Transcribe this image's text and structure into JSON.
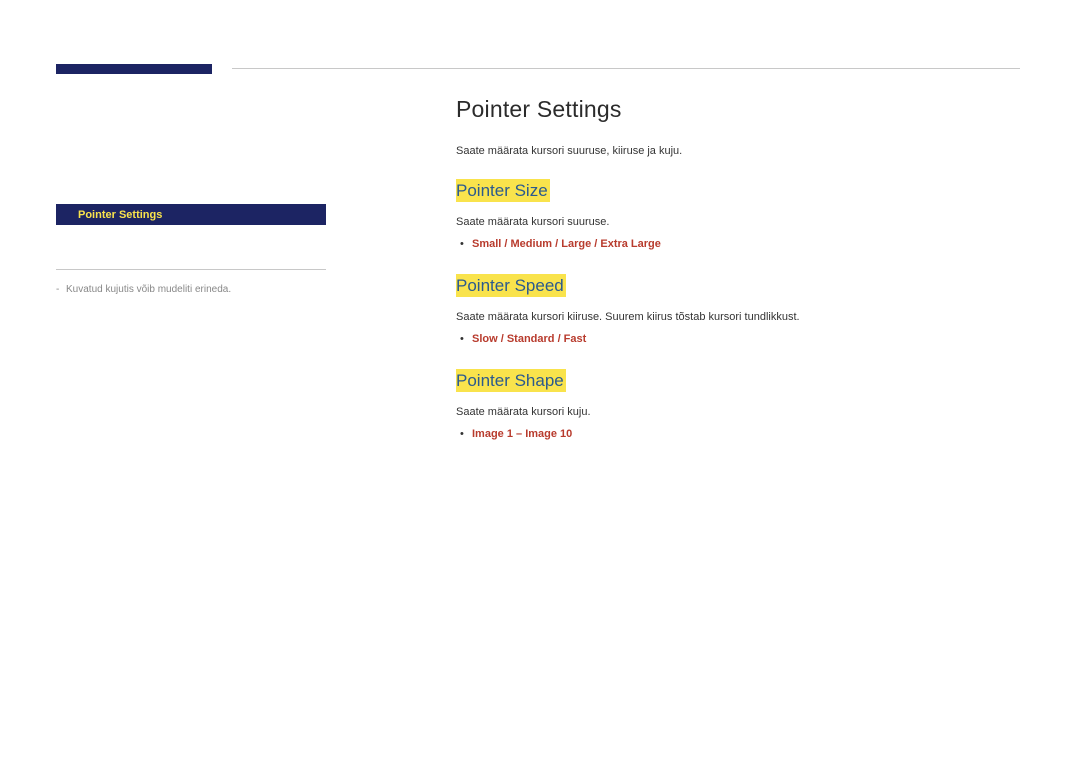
{
  "header": {
    "accentColor": "#1c2463"
  },
  "sidebar": {
    "selectedItem": "Pointer Settings",
    "note": "Kuvatud kujutis võib mudeliti erineda."
  },
  "main": {
    "title": "Pointer Settings",
    "intro": "Saate määrata kursori suuruse, kiiruse ja kuju.",
    "sections": [
      {
        "heading": "Pointer Size",
        "description": "Saate määrata kursori suuruse.",
        "options": "Small / Medium / Large / Extra Large"
      },
      {
        "heading": "Pointer Speed",
        "description": "Saate määrata kursori kiiruse. Suurem kiirus tõstab kursori tundlikkust.",
        "options": "Slow / Standard / Fast"
      },
      {
        "heading": "Pointer Shape",
        "description": "Saate määrata kursori kuju.",
        "options": "Image 1 – Image 10"
      }
    ]
  }
}
